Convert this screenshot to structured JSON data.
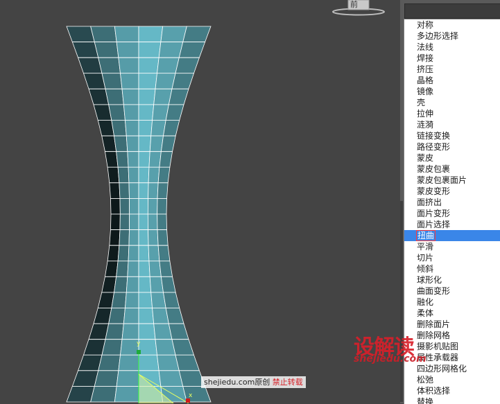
{
  "viewport": {
    "label": "前",
    "axis_y": "y",
    "axis_x": "x"
  },
  "modifier_list": {
    "items": [
      "对称",
      "多边形选择",
      "法线",
      "焊接",
      "挤压",
      "晶格",
      "镜像",
      "壳",
      "拉伸",
      "涟漪",
      "链接变换",
      "路径变形",
      "蒙皮",
      "蒙皮包裹",
      "蒙皮包裹面片",
      "蒙皮变形",
      "面挤出",
      "面片变形",
      "面片选择",
      "扭曲",
      "平滑",
      "切片",
      "倾斜",
      "球形化",
      "曲面变形",
      "融化",
      "柔体",
      "删除面片",
      "删除网格",
      "摄影机贴图",
      "属性承载器",
      "四边形网格化",
      "松弛",
      "体积选择",
      "替换"
    ],
    "selected": "扭曲"
  },
  "watermark": {
    "logo_text": "设解读",
    "url": "shejiedu.com"
  },
  "credit": {
    "site": "shejiedu.com",
    "original": "原创",
    "notice": "禁止转载"
  },
  "colors": {
    "background": "#444444",
    "selection": "#3a86e8",
    "mesh_edge": "#ffffff"
  }
}
